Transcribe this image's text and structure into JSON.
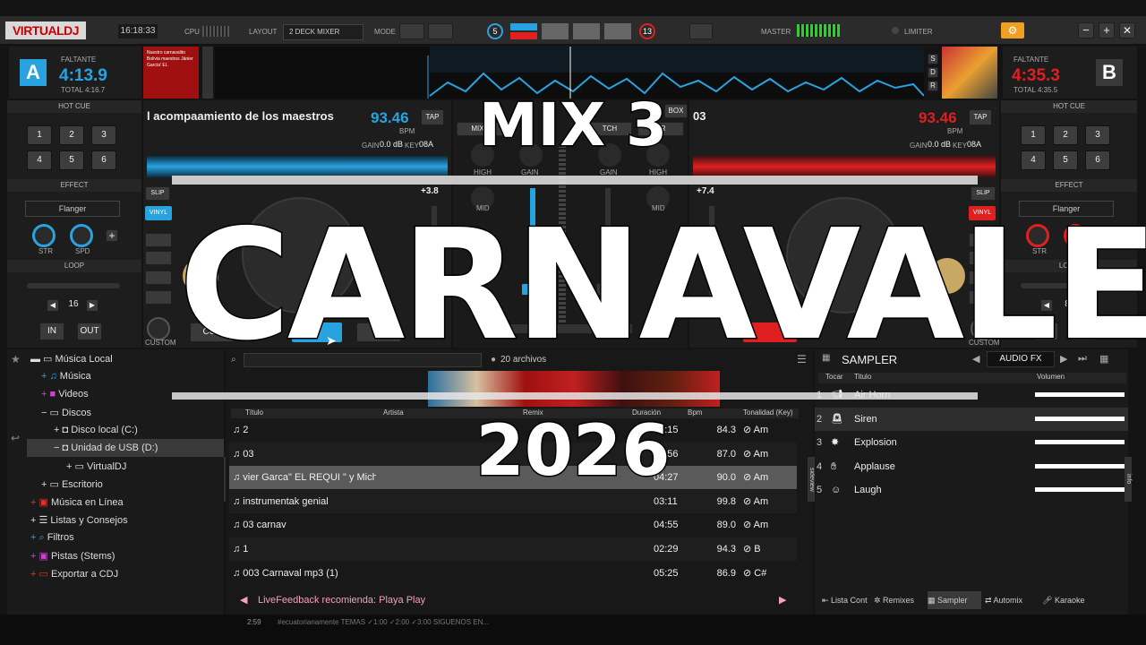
{
  "window": {
    "buttons": [
      "−",
      "+",
      "✕"
    ]
  },
  "top": {
    "logo": "VIRTUALDJ",
    "clock": "16:18:33",
    "cpu_label": "CPU",
    "layout_label": "LAYOUT",
    "layout_value": "2 DECK MIXER",
    "mode_label": "MODE",
    "counter_left": "5",
    "counter_right": "13",
    "master_label": "MASTER",
    "limiter_label": "LIMITER"
  },
  "deckA": {
    "letter": "A",
    "remain_label": "FALTANTE",
    "time": "4:13.9",
    "total": "TOTAL 4:16.7",
    "title": "l acompaamiento de los maestros",
    "bpm": "93.46",
    "bpm_label": "BPM",
    "tap": "TAP",
    "gain": "GAIN",
    "gain_value": "0.0 dB",
    "key_label": "KEY",
    "key_value": "08A",
    "pitch": "+3.8",
    "cover_text": "Nuestro carnavalito Bolivia maestros Jánier García' EL",
    "cue": "CUE",
    "slip": "SLIP",
    "vinyl": "VINYL",
    "custom": "CUSTOM",
    "hotcue": "HOT CUE",
    "hotcues": [
      "1",
      "2",
      "3",
      "4",
      "5",
      "6"
    ],
    "effect": "EFFECT",
    "effect_value": "Flanger",
    "str": "STR",
    "spd": "SPD",
    "loop": "LOOP",
    "loop_value": "16",
    "in": "IN",
    "out": "OUT",
    "sync": "NC"
  },
  "deckB": {
    "letter": "B",
    "remain_label": "FALTANTE",
    "time": "4:35.3",
    "total": "TOTAL 4:35.5",
    "title": "03",
    "bpm": "93.46",
    "bpm_label": "BPM",
    "tap": "TAP",
    "gain": "GAIN",
    "gain_value": "0.0 dB",
    "key_label": "KEY",
    "key_value": "08A",
    "pitch": "+7.4",
    "slip": "SLIP",
    "vinyl": "VINYL",
    "custom": "CUSTOM",
    "hotcue": "HOT CUE",
    "hotcues": [
      "1",
      "2",
      "3",
      "4",
      "5",
      "6"
    ],
    "effect": "EFFECT",
    "effect_value": "Flanger",
    "str": "STR",
    "spd": "SPD",
    "loop": "LOOP",
    "loop_value": "8",
    "in": "IN",
    "out": "OUT",
    "sdr": [
      "S",
      "D",
      "R"
    ]
  },
  "mixer": {
    "tab_mixer": "MIXER",
    "tab_box": "BOX",
    "tab_tch": "TCH",
    "tab_er": "ER",
    "high": "HIGH",
    "gain": "GAIN",
    "mid": "MID"
  },
  "overlay": {
    "line1": "MIX 3",
    "line2": "CARNAVALES",
    "line3": "2026"
  },
  "browser": {
    "tree": [
      "Música Local",
      "Música",
      "Videos",
      "Discos",
      "Disco local (C:)",
      "Unidad de USB (D:)",
      "VirtualDJ",
      "Escritorio",
      "Música en Línea",
      "Listas y Consejos",
      "Filtros",
      "Pistas (Stems)",
      "Exportar a CDJ"
    ],
    "count": "20 archivos",
    "headers": {
      "title": "Título",
      "artist": "Artista",
      "remix": "Remix",
      "duration": "Duración",
      "bpm": "Bpm",
      "key": "Tonalidad (Key)"
    },
    "rows": [
      {
        "title": "2",
        "duration": "06:15",
        "bpm": "84.3",
        "key": "Am"
      },
      {
        "title": "03",
        "duration": "04:56",
        "bpm": "87.0",
        "key": "Am"
      },
      {
        "title": "vier Garca\" EL REQUI \" y Michel Gutirrez S",
        "duration": "04:27",
        "bpm": "90.0",
        "key": "Am"
      },
      {
        "title": "instrumentak genial",
        "duration": "03:11",
        "bpm": "99.8",
        "key": "Am"
      },
      {
        "title": "03 carnav",
        "duration": "04:55",
        "bpm": "89.0",
        "key": "Am"
      },
      {
        "title": "1",
        "duration": "02:29",
        "bpm": "94.3",
        "key": "B"
      },
      {
        "title": "003 Carnaval mp3 (1)",
        "duration": "05:25",
        "bpm": "86.9",
        "key": "C#"
      }
    ],
    "live_feedback": "LiveFeedback recomienda: Playa Play",
    "folders_tab": "folders",
    "sideview_tab": "sideview"
  },
  "sampler": {
    "title": "SAMPLER",
    "fx": "AUDIO FX",
    "col_play": "Tocar",
    "col_title": "Titulo",
    "col_volume": "Volumen",
    "rows": [
      {
        "n": "1",
        "name": "Air Horn"
      },
      {
        "n": "2",
        "name": "Siren"
      },
      {
        "n": "3",
        "name": "Explosion"
      },
      {
        "n": "4",
        "name": "Applause"
      },
      {
        "n": "5",
        "name": "Laugh"
      }
    ],
    "tabs": [
      "Lista Cont",
      "Remixes",
      "Sampler",
      "Automix",
      "Karaoke"
    ],
    "info_tab": "info"
  },
  "status": {
    "time": "2:59",
    "ticker": "#ecuatorianamente TEMAS ✓1:00 ✓2:00 ✓3:00 SIGUENOS EN..."
  },
  "colors": {
    "deckA": "#29a3e0",
    "deckB": "#e02020",
    "accent": "#f0a020"
  }
}
